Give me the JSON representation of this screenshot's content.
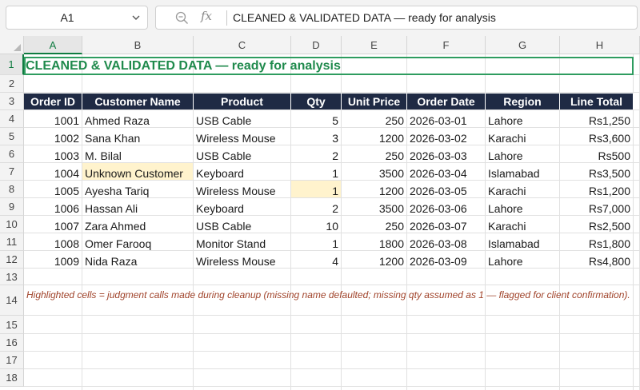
{
  "formula_bar": {
    "cell_ref": "A1",
    "fx_label": "fx",
    "content": "CLEANED & VALIDATED DATA — ready for analysis"
  },
  "columns": [
    "A",
    "B",
    "C",
    "D",
    "E",
    "F",
    "G",
    "H"
  ],
  "rows": [
    "1",
    "2",
    "3",
    "4",
    "5",
    "6",
    "7",
    "8",
    "9",
    "10",
    "11",
    "12",
    "13",
    "14",
    "15",
    "16",
    "17",
    "18"
  ],
  "sheet": {
    "title": "CLEANED & VALIDATED DATA — ready for analysis",
    "headers": [
      "Order ID",
      "Customer Name",
      "Product",
      "Qty",
      "Unit Price",
      "Order Date",
      "Region",
      "Line Total"
    ],
    "records": [
      [
        "1001",
        "Ahmed Raza",
        "USB Cable",
        "5",
        "250",
        "2026-03-01",
        "Lahore",
        "Rs1,250"
      ],
      [
        "1002",
        "Sana Khan",
        "Wireless Mouse",
        "3",
        "1200",
        "2026-03-02",
        "Karachi",
        "Rs3,600"
      ],
      [
        "1003",
        "M. Bilal",
        "USB Cable",
        "2",
        "250",
        "2026-03-03",
        "Lahore",
        "Rs500"
      ],
      [
        "1004",
        "Unknown Customer",
        "Keyboard",
        "1",
        "3500",
        "2026-03-04",
        "Islamabad",
        "Rs3,500"
      ],
      [
        "1005",
        "Ayesha Tariq",
        "Wireless Mouse",
        "1",
        "1200",
        "2026-03-05",
        "Karachi",
        "Rs1,200"
      ],
      [
        "1006",
        "Hassan Ali",
        "Keyboard",
        "2",
        "3500",
        "2026-03-06",
        "Lahore",
        "Rs7,000"
      ],
      [
        "1007",
        "Zara Ahmed",
        "USB Cable",
        "10",
        "250",
        "2026-03-07",
        "Karachi",
        "Rs2,500"
      ],
      [
        "1008",
        "Omer Farooq",
        "Monitor Stand",
        "1",
        "1800",
        "2026-03-08",
        "Islamabad",
        "Rs1,800"
      ],
      [
        "1009",
        "Nida Raza",
        "Wireless Mouse",
        "4",
        "1200",
        "2026-03-09",
        "Lahore",
        "Rs4,800"
      ]
    ],
    "note": "Highlighted cells = judgment calls made during cleanup (missing name defaulted; missing qty assumed as 1 — flagged for client confirmation)."
  },
  "colors": {
    "header_bg": "#1f2a44",
    "title_green": "#1f8a4c",
    "highlight": "#fff3cd",
    "note_text": "#a0432a",
    "selection": "#107c41"
  },
  "highlighted_cells": [
    "B7",
    "D8"
  ],
  "selected_cell": "A1"
}
